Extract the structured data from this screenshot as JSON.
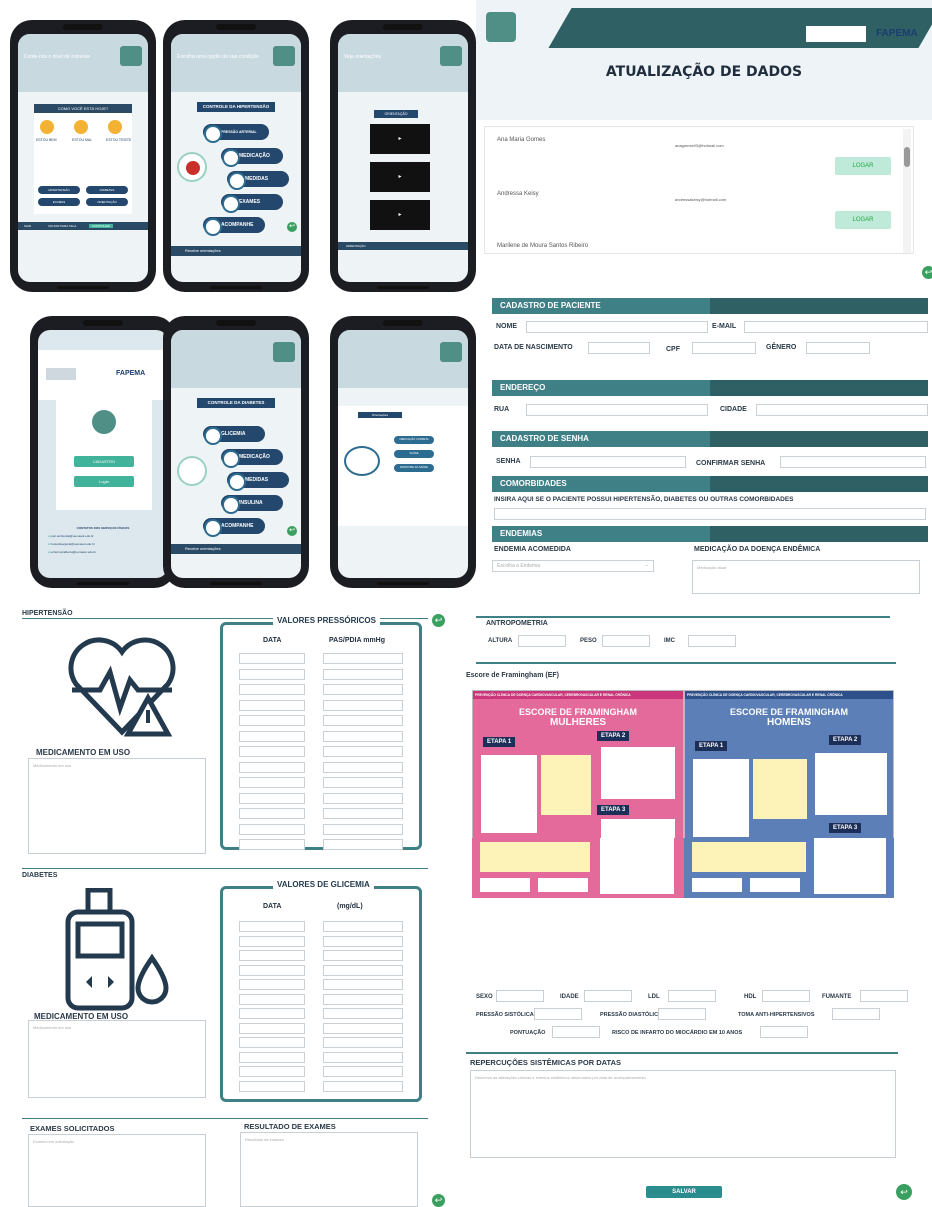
{
  "phones": {
    "p1": {
      "head": "Conte-nos o nivel de estresse",
      "question": "COMO VOCÊ ESTÁ HOJE?",
      "moods": [
        "ESTOU BEM",
        "ESTOU MAL",
        "ESTOU TRISTE"
      ],
      "buttons": [
        "HIPERTENSÃO",
        "DIABETES",
        "EXAMES",
        "ORIENTAÇÃO"
      ],
      "nav": [
        "SAIR",
        "VOLTAR PARA TELA",
        "CONTINUAR"
      ]
    },
    "p2": {
      "head": "Escolha uma opção da sua condição",
      "title": "CONTROLE DA HIPERTENSÃO",
      "nodes": [
        "PRESSÃO ARTERIAL",
        "MEDICAÇÃO",
        "MEDIDAS",
        "EXAMES",
        "ACOMPANHE"
      ],
      "footer": "Recebe orientações"
    },
    "p3": {
      "head": "Veja orientações",
      "title": "ORIENTAÇÃO",
      "footer": "ORIENTAÇÃO"
    },
    "p4": {
      "brand": "FAPEMA",
      "btn1": "CADASTRO",
      "btn2": "Login",
      "contacts_title": "CONTATOS DOS SERVIÇOS FÍSICOS",
      "contacts": [
        "psic.ambiental@uemasul.edu.br",
        "hosterkiavgeral@uemasul.edu.br",
        "enfermeiralberto@uemasul.edu.br"
      ]
    },
    "p5": {
      "title": "CONTROLE DA DIABETES",
      "nodes": [
        "GLICEMIA",
        "MEDICAÇÃO",
        "MEDIDAS",
        "INSULINA",
        "ACOMPANHE"
      ],
      "footer": "Recebe orientações"
    },
    "p6": {
      "title": "Orientações",
      "opts": [
        "MEDICAÇÃO CORRETA",
        "SAÚDE",
        "MONITORE DA SAÚDE"
      ]
    }
  },
  "update": {
    "title": "ATUALIZAÇÃO DE DADOS",
    "brand": "FAPEMA",
    "rows": [
      {
        "name": "Ana Maria Gomes",
        "email": "anagomes93@hotmail.com",
        "btn": "LOGAR"
      },
      {
        "name": "Andressa Keisy",
        "email": "andressakeisy@hotmail.com",
        "btn": "LOGAR"
      },
      {
        "name": "Marilene de Moura Santos Ribeiro",
        "email": "",
        "btn": ""
      }
    ]
  },
  "form": {
    "cadastro": "CADASTRO DE PACIENTE",
    "nome": "NOME",
    "email": "E-MAIL",
    "nasc": "DATA DE NASCIMENTO",
    "cpf": "CPF",
    "genero": "GÊNERO",
    "endereco": "ENDEREÇO",
    "rua": "RUA",
    "cidade": "CIDADE",
    "senha_title": "CADASTRO DE SENHA",
    "senha": "SENHA",
    "confirmar": "CONFIRMAR SENHA",
    "comorb": "COMORBIDADES",
    "comorb_txt": "INSIRA AQUI SE O PACIENTE POSSUI HIPERTENSÃO, DIABETES OU OUTRAS COMORBIDADES",
    "endemias": "ENDEMIAS",
    "endemia_acom": "ENDEMIA ACOMEDIDA",
    "endemia_sel": "Escolha a Endemia",
    "med_end": "MEDICAÇÃO DA DOENÇA ENDÊMICA",
    "med_end_ph": "Medicação atual"
  },
  "hiper": {
    "title": "HIPERTENSÃO",
    "values": "VALORES PRESSÓRICOS",
    "col1": "DATA",
    "col2": "PAS/PDIA mmHg",
    "med": "MEDICAMENTO EM USO",
    "med_ph": "Medicamento em uso"
  },
  "diab": {
    "title": "DIABETES",
    "values": "VALORES  DE GLICEMIA",
    "col1": "DATA",
    "col2": "(mg/dL)",
    "med": "MEDICAMENTO EM USO",
    "med_ph": "Medicamento em uso"
  },
  "exams": {
    "sol": "EXAMES SOLICITADOS",
    "sol_ph": "Exames em solicitação",
    "res": "RESULTADO DE EXAMES",
    "res_ph": "Resultado de exames"
  },
  "antro": {
    "title": "ANTROPOMETRIA",
    "altura": "ALTURA",
    "peso": "PESO",
    "imc": "IMC"
  },
  "fram": {
    "title": "Escore de Framingham (EF)",
    "card_head": "PREVENÇÃO CLÍNICA DE DOENÇA CARDIOVASCULAR, CEREBROVASCULAR E RENAL CRÔNICA",
    "w_title": "ESCORE DE FRAMINGHAM",
    "w_sub": "MULHERES",
    "m_title": "ESCORE DE FRAMINGHAM",
    "m_sub": "HOMENS",
    "etapa1": "ETAPA 1",
    "etapa2": "ETAPA 2",
    "etapa3": "ETAPA 3"
  },
  "risk": {
    "sexo": "SEXO",
    "idade": "IDADE",
    "ldl": "LDL",
    "hdl": "HDL",
    "fumante": "FUMANTE",
    "pas": "PRESSÃO SISTÓLICA",
    "pad": "PRESSÃO DIASTÓLICA",
    "anti": "TOMA ANTI-HIPERTENSIVOS",
    "pont": "PONTUAÇÃO",
    "risco": "RISCO DE INFARTO DO MIOCÁRDIO EM 10 ANOS"
  },
  "reperc": {
    "title": "REPERCUÇÕES SISTÊMICAS POR DATAS",
    "ph": "Descreva as alterações clínicas e eventos sistêmicos observados por data de acompanhamento"
  },
  "save": "SALVAR",
  "colors": {
    "teal": "#3f7f86",
    "navy": "#23476d",
    "green": "#41b39a"
  }
}
